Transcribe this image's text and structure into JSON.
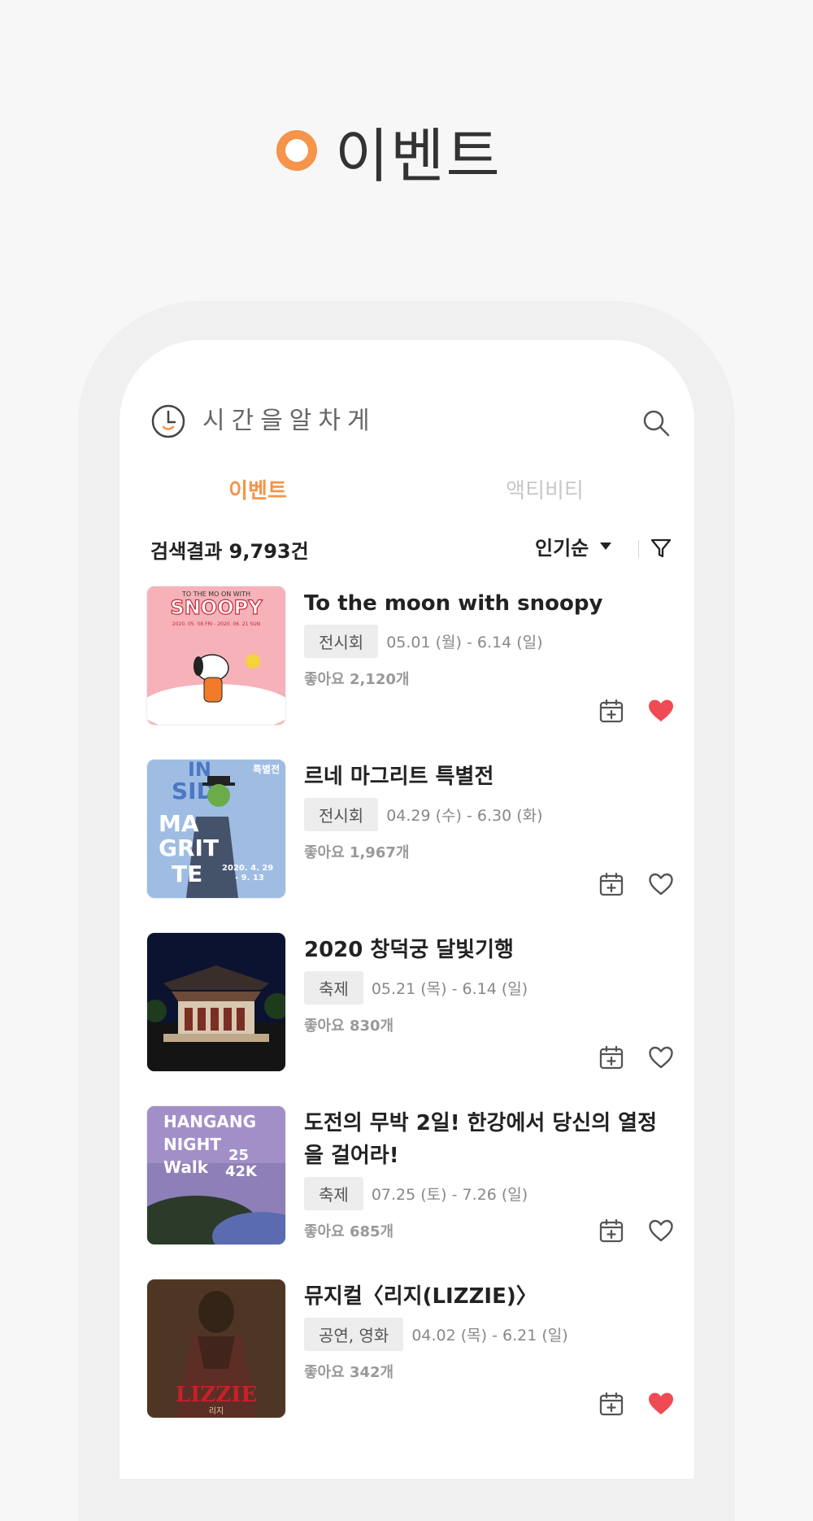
{
  "section_title": "이벤트",
  "app": {
    "title": "시간을알차게"
  },
  "tabs": [
    {
      "label": "이벤트",
      "active": true
    },
    {
      "label": "액티비티",
      "active": false
    }
  ],
  "results": {
    "count_text": "검색결과 9,793건",
    "sort_label": "인기순"
  },
  "colors": {
    "accent": "#f5944a",
    "liked": "#f04a54"
  },
  "events": [
    {
      "title": "To the moon with snoopy",
      "tag": "전시회",
      "date": "05.01 (월) - 6.14 (일)",
      "likes": "좋아요 2,120개",
      "liked": true,
      "thumb_text": [
        "TO THE MO ON WITH",
        "SNOOPY",
        "2020. 05. 08 FRI - 2020. 06. 21 SUN"
      ]
    },
    {
      "title": "르네 마그리트 특별전",
      "tag": "전시회",
      "date": "04.29 (수) - 6.30 (화)",
      "likes": "좋아요 1,967개",
      "liked": false,
      "thumb_text": [
        "IN",
        "SIDE",
        "MA",
        "GRIT",
        "TE",
        "특별전",
        "2020. 4. 29",
        "- 9. 13"
      ]
    },
    {
      "title": "2020 창덕궁 달빛기행",
      "tag": "축제",
      "date": "05.21 (목) - 6.14 (일)",
      "likes": "좋아요 830개",
      "liked": false,
      "thumb_text": []
    },
    {
      "title": "도전의 무박 2일! 한강에서 당신의 열정을 걸어라!",
      "tag": "축제",
      "date": "07.25 (토) - 7.26 (일)",
      "likes": "좋아요 685개",
      "liked": false,
      "thumb_text": [
        "HANGANG",
        "NIGHT",
        "Walk",
        "25",
        "42K"
      ]
    },
    {
      "title": "뮤지컬〈리지(LIZZIE)〉",
      "tag": "공연, 영화",
      "date": "04.02 (목) - 6.21 (일)",
      "likes": "좋아요 342개",
      "liked": true,
      "thumb_text": [
        "LIZZIE",
        "리지"
      ]
    }
  ]
}
